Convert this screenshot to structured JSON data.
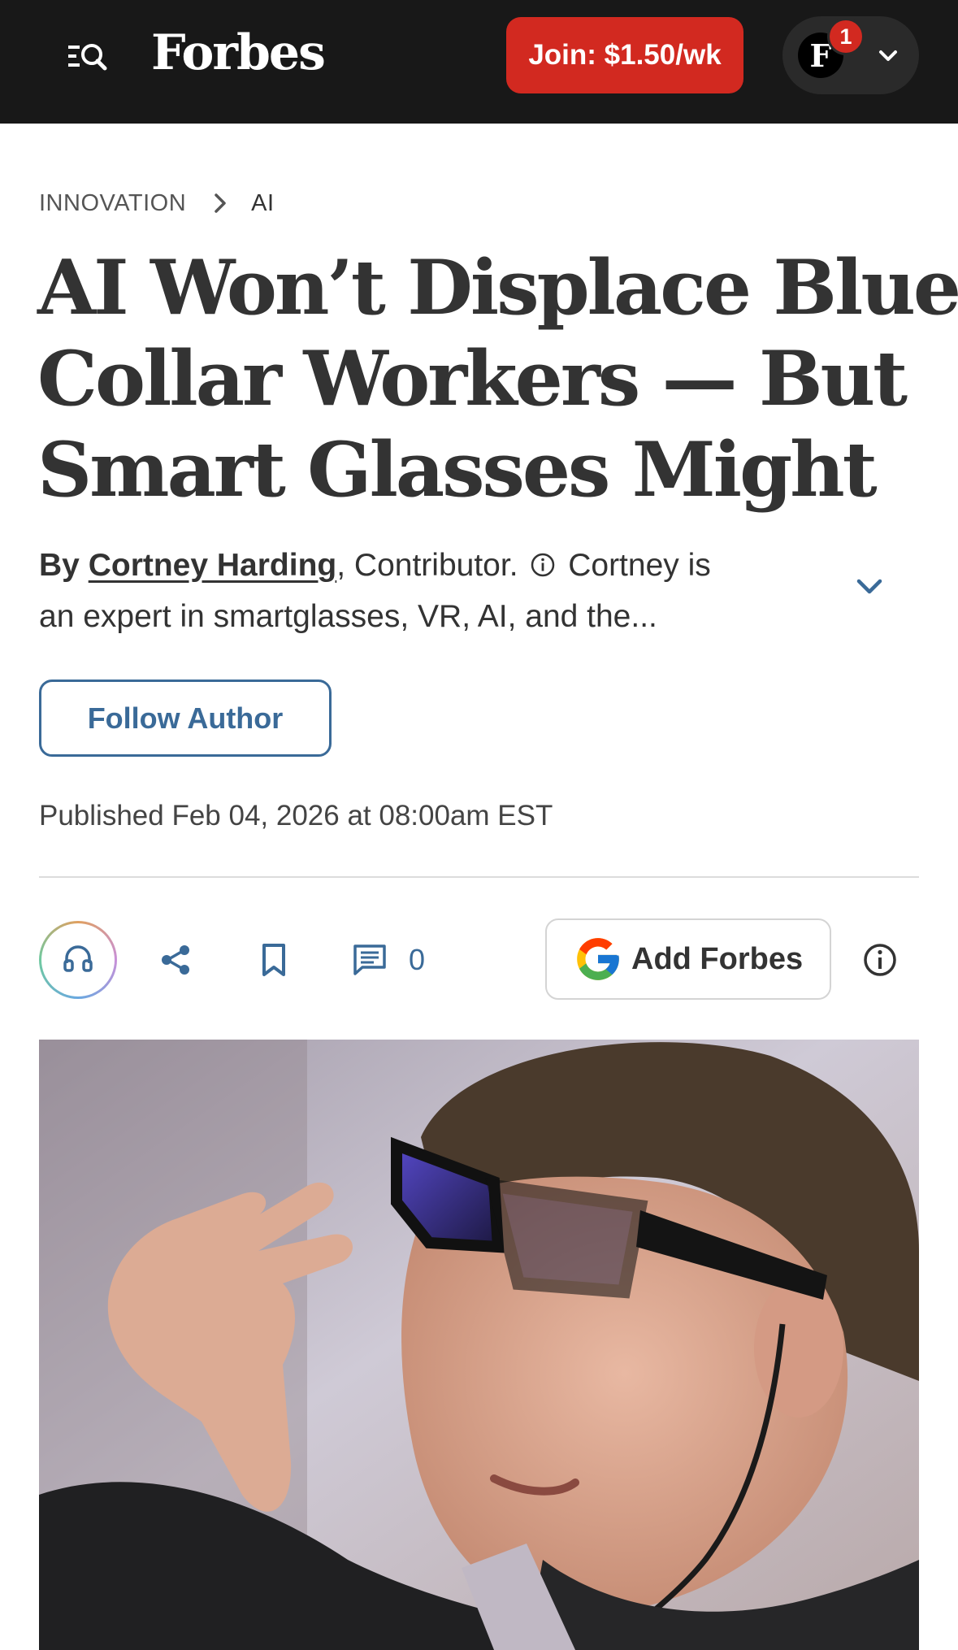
{
  "nav": {
    "logo": "Forbes",
    "join_label": "Join: $1.50/wk",
    "avatar_initial": "F",
    "notification_count": "1",
    "brand_color": "#d22920"
  },
  "breadcrumb": {
    "section": "INNOVATION",
    "topic": "AI"
  },
  "article": {
    "headline_lines": [
      "AI Won’t Displace Blue",
      "Collar Workers — But",
      "Smart Glasses Might"
    ],
    "byline": {
      "prefix": "By",
      "author": "Cortney Harding",
      "comma": ",",
      "role": "Contributor.",
      "bio_part1": "Cortney is",
      "bio_part2": "an expert in smartglasses, VR, AI, and the..."
    },
    "follow_label": "Follow Author",
    "published": "Published Feb 04, 2026 at 08:00am EST"
  },
  "actions": {
    "comment_count": "0",
    "add_forbes_label": "Add Forbes",
    "icons": [
      "menu-search-icon",
      "headphones-icon",
      "share-icon",
      "bookmark-icon",
      "comment-icon",
      "google-icon",
      "info-icon"
    ],
    "accent_color": "#3a6a98"
  }
}
